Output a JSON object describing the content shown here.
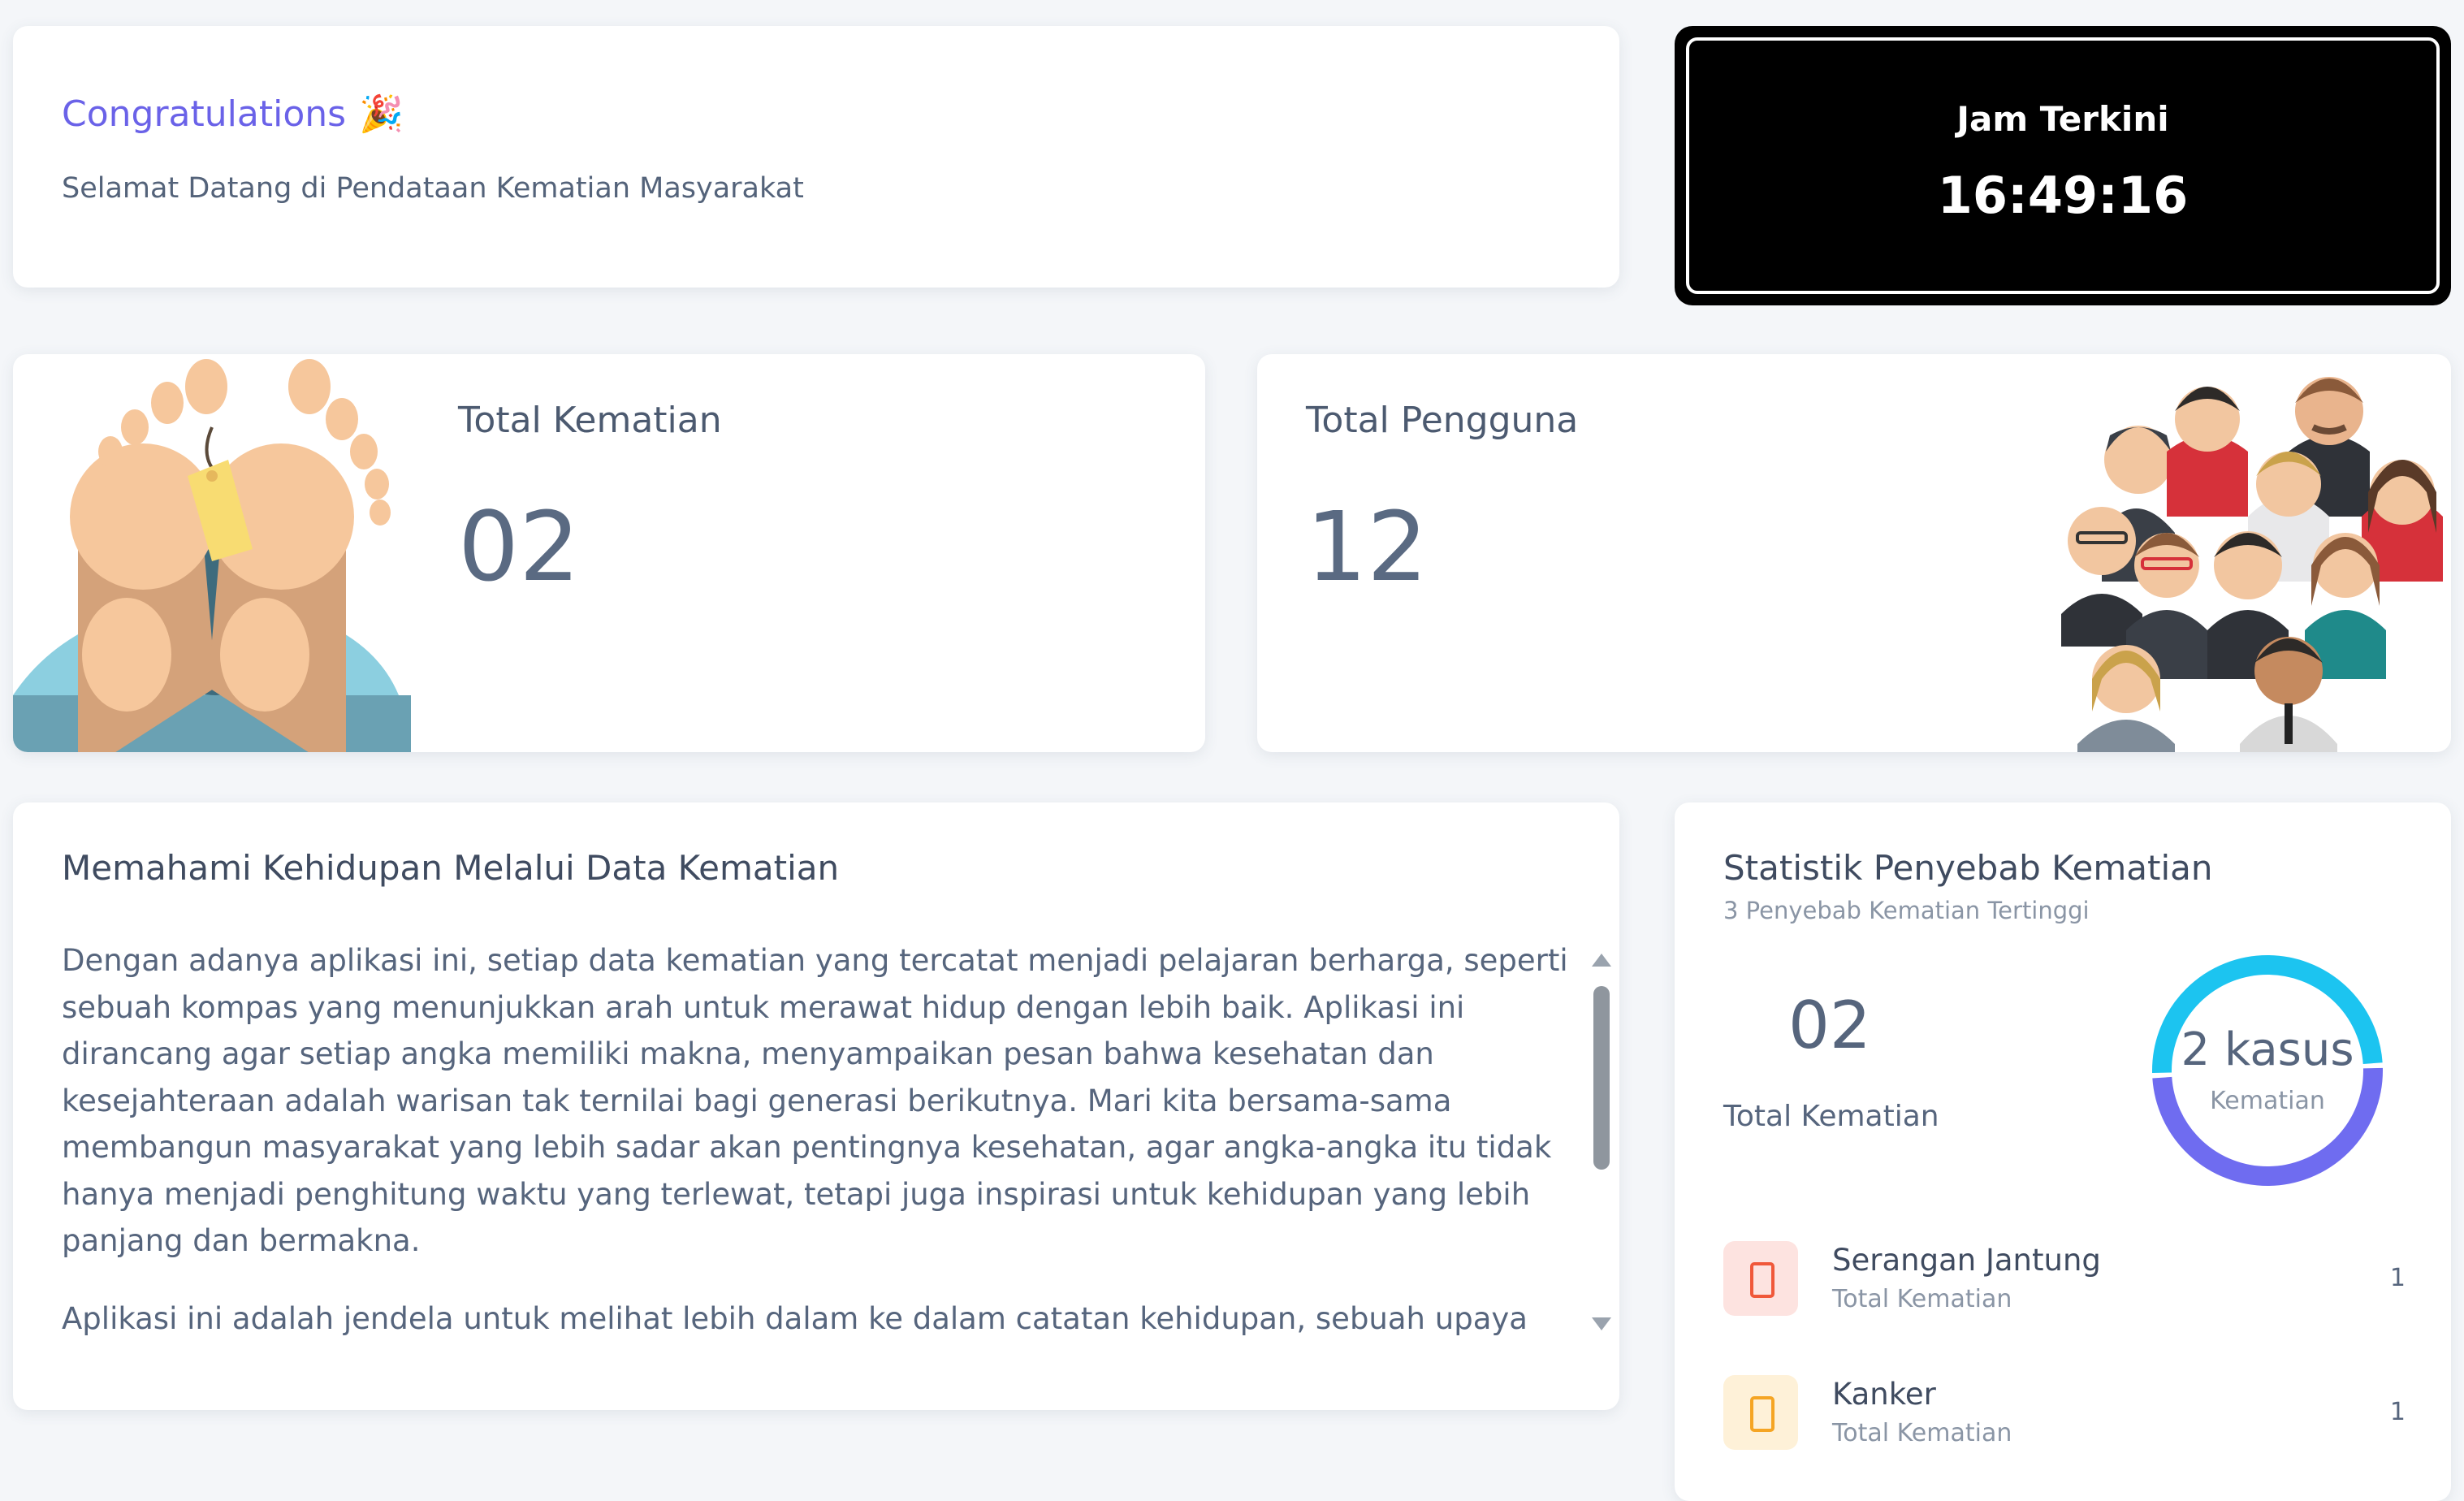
{
  "welcome": {
    "title": "Congratulations",
    "party_icon": "🎉",
    "subtitle": "Selamat Datang di Pendataan Kematian Masyarakat"
  },
  "clock": {
    "label": "Jam Terkini",
    "time": "16:49:16"
  },
  "stats": {
    "deaths": {
      "label": "Total Kematian",
      "value": "02",
      "illustration": "feet-with-toe-tag"
    },
    "users": {
      "label": "Total Pengguna",
      "value": "12",
      "illustration": "group-of-people"
    }
  },
  "article": {
    "heading": "Memahami Kehidupan Melalui Data Kematian",
    "paragraphs": [
      "Dengan adanya aplikasi ini, setiap data kematian yang tercatat menjadi pelajaran berharga, seperti sebuah kompas yang menunjukkan arah untuk merawat hidup dengan lebih baik. Aplikasi ini dirancang agar setiap angka memiliki makna, menyampaikan pesan bahwa kesehatan dan kesejahteraan adalah warisan tak ternilai bagi generasi berikutnya. Mari kita bersama-sama membangun masyarakat yang lebih sadar akan pentingnya kesehatan, agar angka-angka itu tidak hanya menjadi penghitung waktu yang terlewat, tetapi juga inspirasi untuk kehidupan yang lebih panjang dan bermakna.",
      "Aplikasi ini adalah jendela untuk melihat lebih dalam ke dalam catatan kehidupan, sebuah upaya lembut yang mengumpulkan jejak-jejak terakhir, yang meninggalkan cerita dalam angka. Di sini, data tidak hanya"
    ]
  },
  "causes": {
    "heading": "Statistik Penyebab Kematian",
    "subheading": "3 Penyebab Kematian Tertinggi",
    "total_value": "02",
    "total_label": "Total Kematian",
    "donut": {
      "center_value": "2 kasus",
      "center_label": "Kematian",
      "colors": [
        "#6f6cf0",
        "#1cc4f0"
      ]
    },
    "items": [
      {
        "name": "Serangan Jantung",
        "sub": "Total Kematian",
        "count": "1",
        "icon": "phone-icon",
        "bg": "#fde3e0",
        "color": "#f0583a"
      },
      {
        "name": "Kanker",
        "sub": "Total Kematian",
        "count": "1",
        "icon": "phone-icon",
        "bg": "#fef1d8",
        "color": "#f5a524"
      }
    ]
  }
}
